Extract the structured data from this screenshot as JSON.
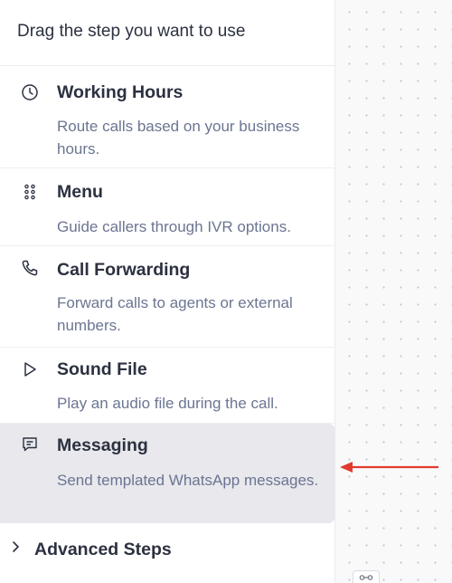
{
  "panel": {
    "title": "Drag the step you want to use",
    "steps": [
      {
        "icon": "clock-icon",
        "title": "Working Hours",
        "description": "Route calls based on your business hours."
      },
      {
        "icon": "grid-dots-icon",
        "title": "Menu",
        "description": "Guide callers through IVR options."
      },
      {
        "icon": "phone-icon",
        "title": "Call Forwarding",
        "description": "Forward calls to agents or external numbers."
      },
      {
        "icon": "play-icon",
        "title": "Sound File",
        "description": "Play an audio file during the call."
      },
      {
        "icon": "message-icon",
        "title": "Messaging",
        "description": "Send templated WhatsApp messages.",
        "highlighted": true
      }
    ],
    "advanced": {
      "label": "Advanced Steps",
      "icon": "chevron-right-icon"
    }
  },
  "canvas": {
    "annotation_arrow_color": "#e03a2e",
    "highlight_color": "#e8e8ed"
  }
}
